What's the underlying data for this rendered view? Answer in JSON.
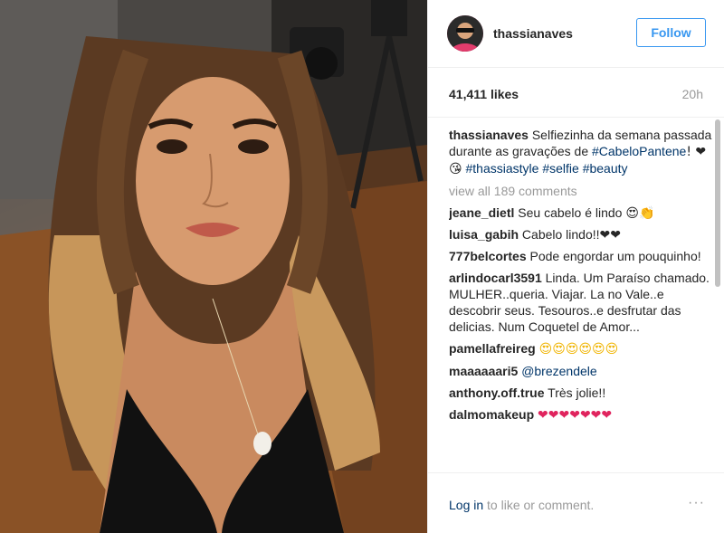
{
  "post": {
    "author": "thassianaves",
    "follow_label": "Follow",
    "likes": "41,411 likes",
    "time": "20h"
  },
  "caption": {
    "user": "thassianaves",
    "text": "Selfiezinha da semana passada durante as gravações de",
    "tag1": "#CabeloPantene",
    "after_tag1": "! ❤😘",
    "tag2": "#thassiastyle",
    "tag3": "#selfie",
    "tag4": "#beauty"
  },
  "view_all": "view all 189 comments",
  "comments": [
    {
      "user": "jeane_dietl",
      "text": "Seu cabelo é lindo 😍👏"
    },
    {
      "user": "luisa_gabih",
      "text": "Cabelo lindo!!❤❤"
    },
    {
      "user": "777belcortes",
      "text": "Pode engordar um pouquinho!"
    },
    {
      "user": "arlindocarl3591",
      "text": "Linda. Um Paraíso chamado. MULHER..queria. Viajar. La no Vale..e descobrir seus. Tesouros..e desfrutar das delicias. Num Coquetel de Amor..."
    },
    {
      "user": "pamellafreireg",
      "text": "😍😍😍😍😍😍"
    },
    {
      "user": "maaaaaari5",
      "text": "@brezendele"
    },
    {
      "user": "anthony.off.true",
      "text": "Très jolie!!"
    },
    {
      "user": "dalmomakeup",
      "text": "❤❤❤❤❤❤❤"
    }
  ],
  "footer": {
    "login_link": "Log in",
    "login_rest": " to like or comment.",
    "more": "···"
  },
  "colors": {
    "link": "#003569",
    "follow": "#3897f0",
    "muted": "#999999"
  },
  "icons": [
    "avatar-image",
    "more-options-icon"
  ]
}
